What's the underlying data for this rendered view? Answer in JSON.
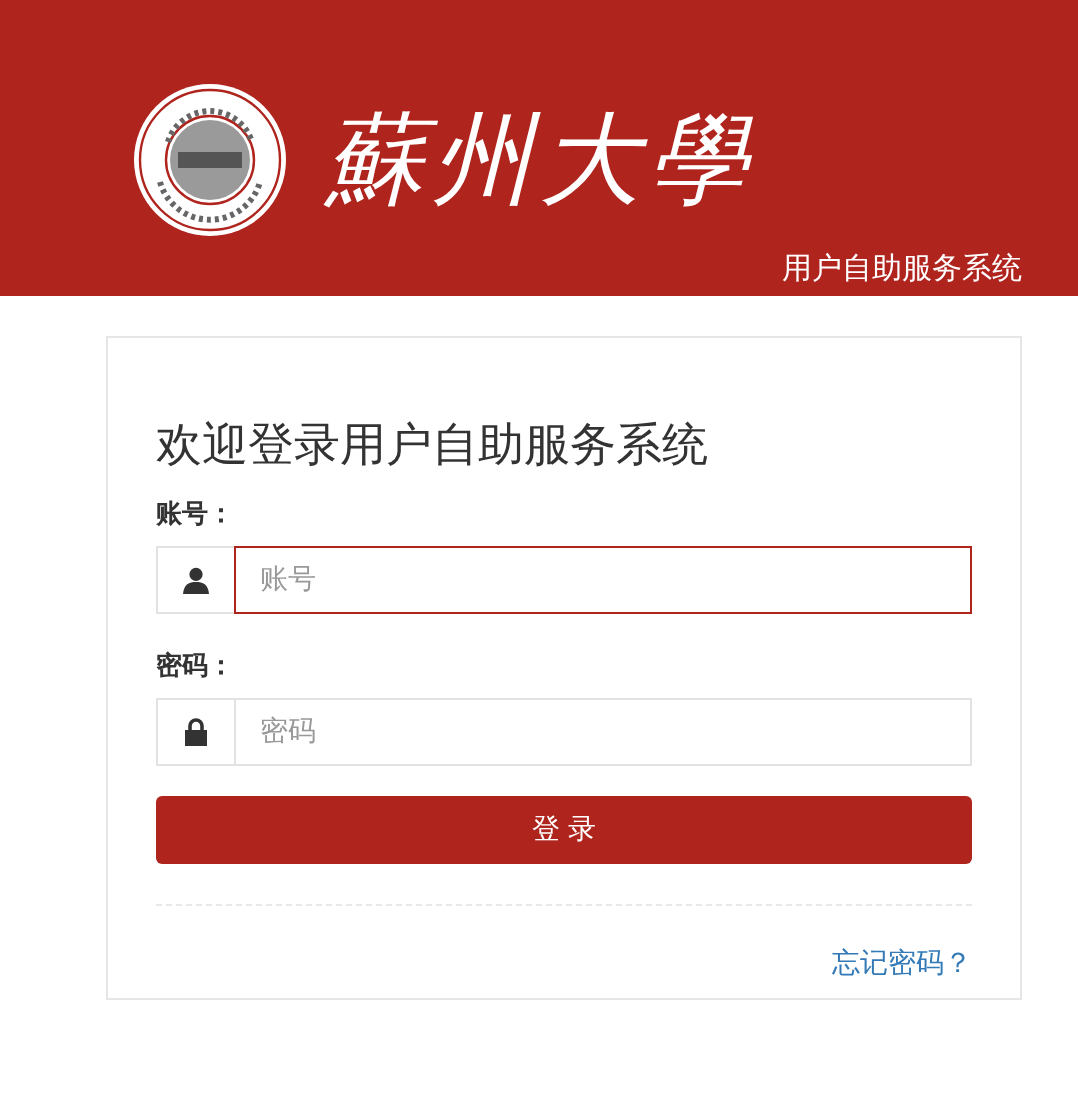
{
  "header": {
    "wordmark": "蘇州大學",
    "subtitle": "用户自助服务系统"
  },
  "login": {
    "title": "欢迎登录用户自助服务系统",
    "fields": [
      {
        "label": "账号：",
        "kind": "user",
        "placeholder": "账号",
        "focused": true
      },
      {
        "label": "密码：",
        "kind": "password",
        "placeholder": "密码",
        "focused": false
      }
    ],
    "submit": "登 录",
    "forgot_link": "忘记密码？"
  }
}
